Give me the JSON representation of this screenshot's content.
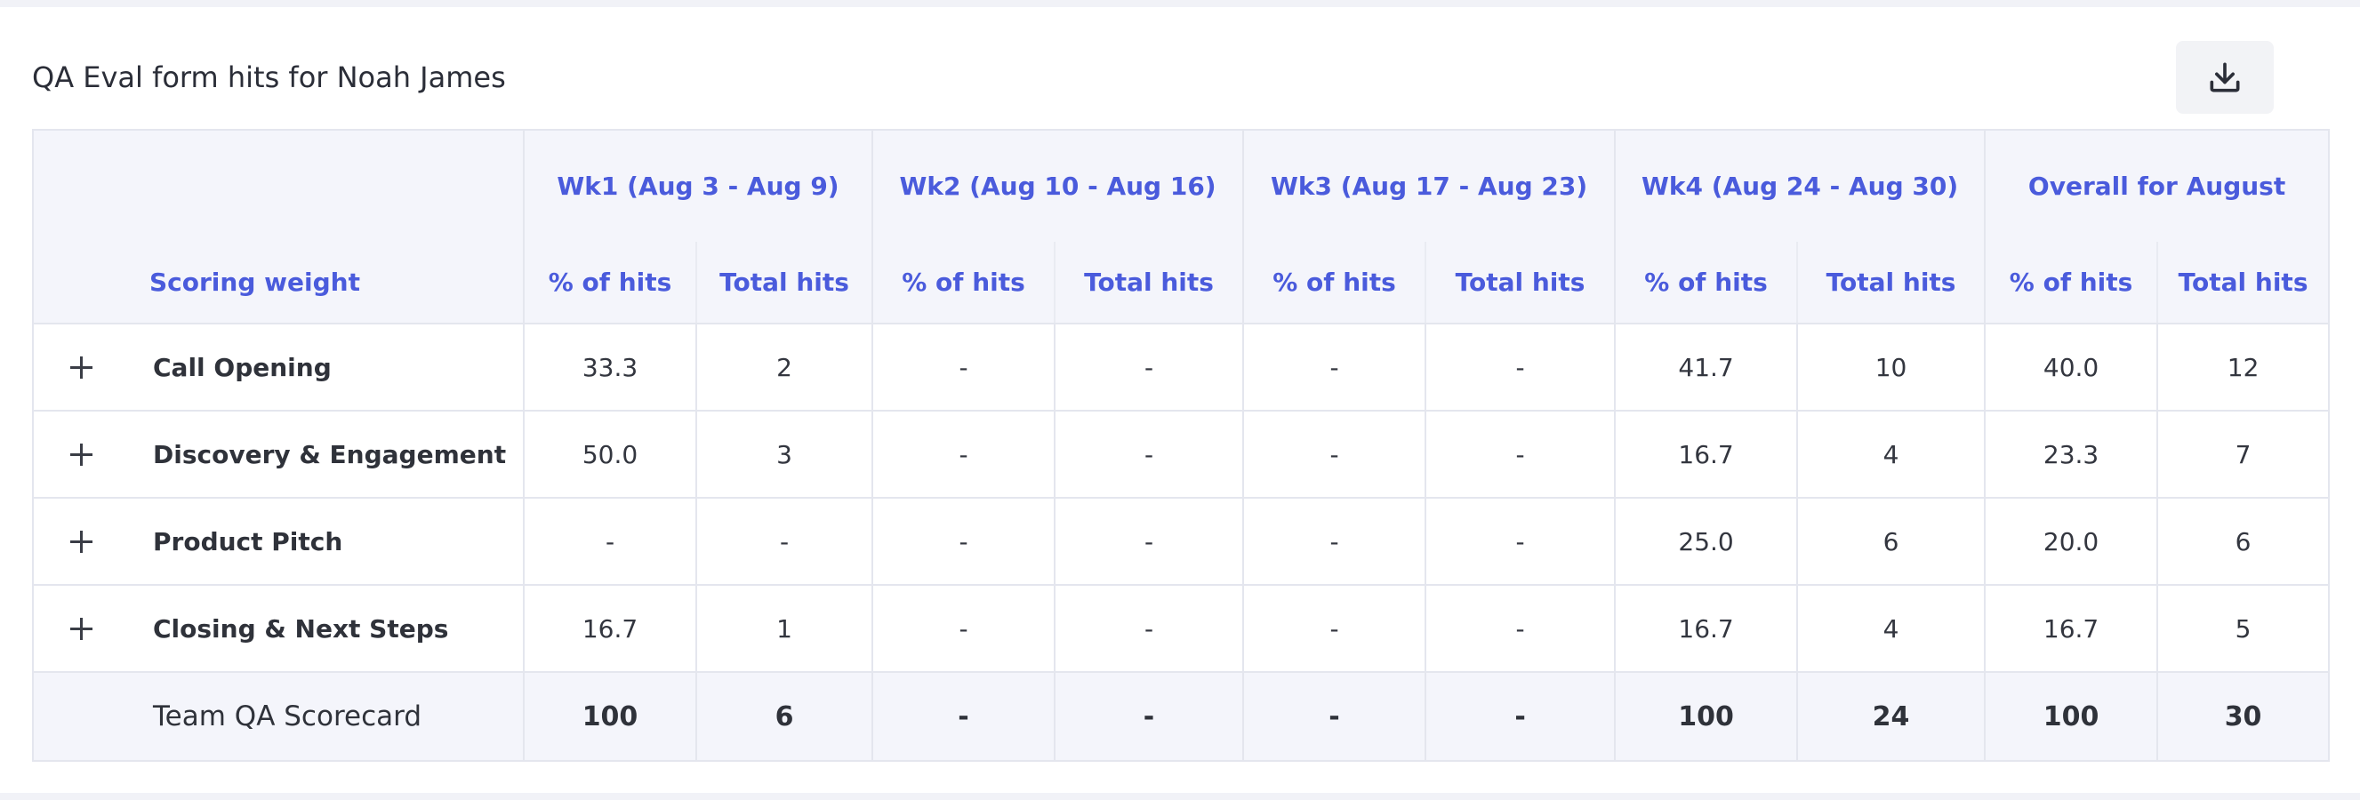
{
  "title": "QA Eval form hits for Noah James",
  "download": {
    "icon": "download-icon"
  },
  "table": {
    "first_header": "Scoring weight",
    "weeks": [
      {
        "label": "Wk1 (Aug 3 - Aug 9)"
      },
      {
        "label": "Wk2 (Aug 10 - Aug 16)"
      },
      {
        "label": "Wk3 (Aug 17 - Aug 23)"
      },
      {
        "label": "Wk4 (Aug 24 - Aug 30)"
      },
      {
        "label": "Overall for August"
      }
    ],
    "sub_headers": {
      "pct": "% of hits",
      "total": "Total hits"
    },
    "rows": [
      {
        "name": "Call Opening",
        "cells": [
          "33.3",
          "2",
          "-",
          "-",
          "-",
          "-",
          "41.7",
          "10",
          "40.0",
          "12"
        ]
      },
      {
        "name": "Discovery & Engagement",
        "cells": [
          "50.0",
          "3",
          "-",
          "-",
          "-",
          "-",
          "16.7",
          "4",
          "23.3",
          "7"
        ]
      },
      {
        "name": "Product Pitch",
        "cells": [
          "-",
          "-",
          "-",
          "-",
          "-",
          "-",
          "25.0",
          "6",
          "20.0",
          "6"
        ]
      },
      {
        "name": "Closing & Next Steps",
        "cells": [
          "16.7",
          "1",
          "-",
          "-",
          "-",
          "-",
          "16.7",
          "4",
          "16.7",
          "5"
        ]
      }
    ],
    "total_row": {
      "name": "Team QA Scorecard",
      "cells": [
        "100",
        "6",
        "-",
        "-",
        "-",
        "-",
        "100",
        "24",
        "100",
        "30"
      ]
    }
  }
}
